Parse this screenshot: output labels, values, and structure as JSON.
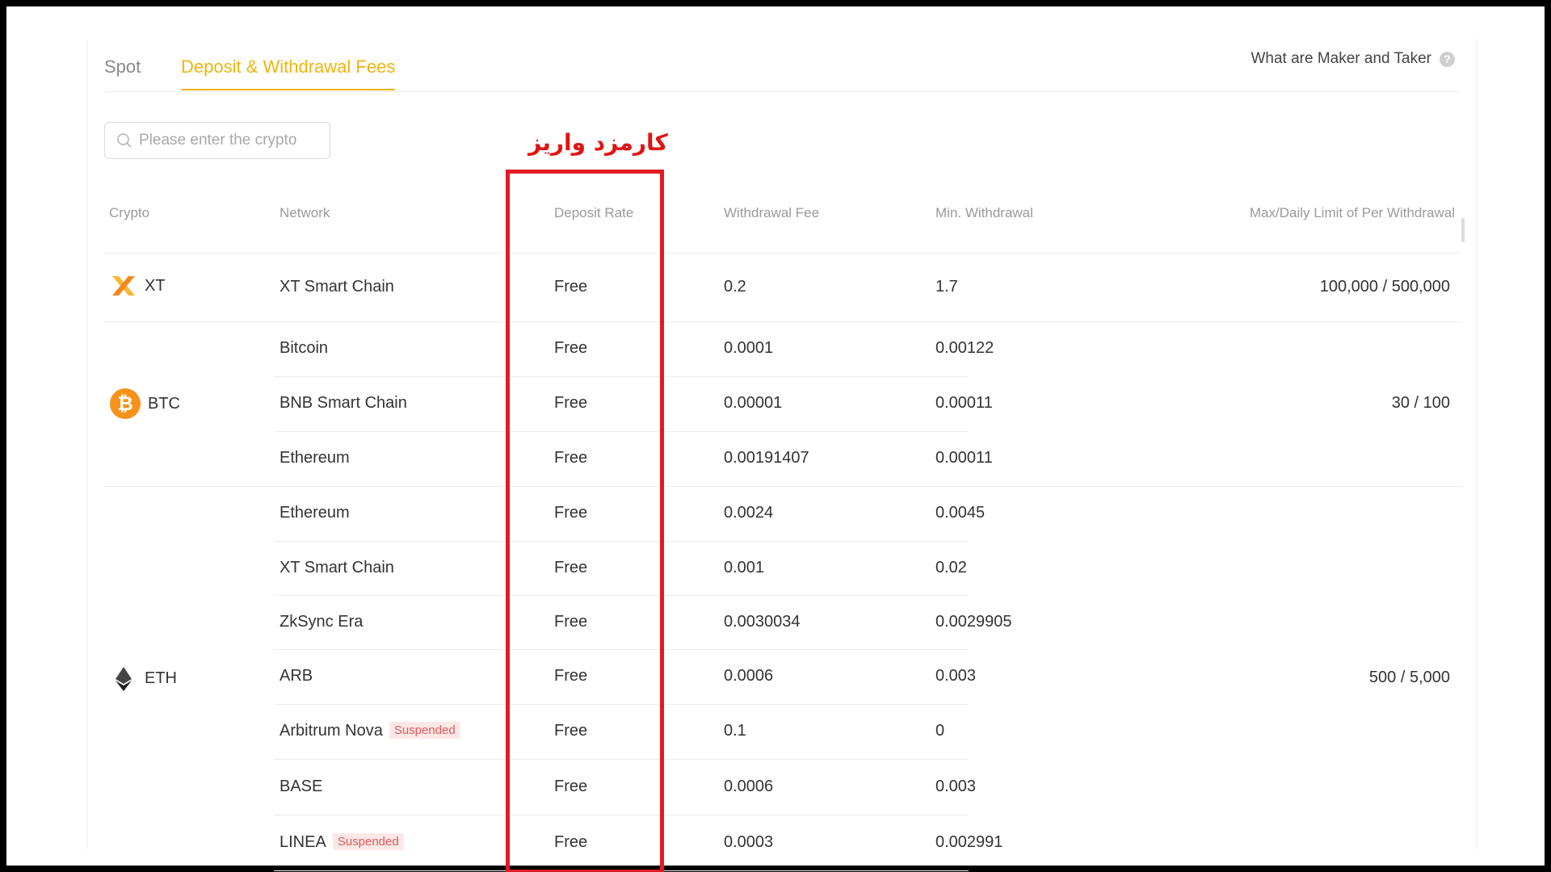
{
  "tabs": [
    {
      "label": "Spot",
      "active": false
    },
    {
      "label": "Deposit & Withdrawal Fees",
      "active": true
    }
  ],
  "help_link": {
    "label": "What are Maker and Taker",
    "icon": "question-icon"
  },
  "search": {
    "placeholder": "Please enter the crypto",
    "value": ""
  },
  "annotation": {
    "label": "کارمزد واریز",
    "color": "#e21b23"
  },
  "colors": {
    "accent": "#f0b40e",
    "annotation": "#e21b23",
    "suspended_bg": "#fde8e8",
    "suspended_text": "#e05a5a"
  },
  "table": {
    "headers": [
      "Crypto",
      "Network",
      "Deposit Rate",
      "Withdrawal Fee",
      "Min. Withdrawal",
      "Max/Daily Limit of Per Withdrawal"
    ],
    "groups": [
      {
        "crypto": "XT",
        "icon": "xt-logo-icon",
        "limit": "100,000 / 500,000",
        "rows": [
          {
            "network": "XT Smart Chain",
            "suspended": "",
            "deposit": "Free",
            "fee": "0.2",
            "min": "1.7"
          }
        ]
      },
      {
        "crypto": "BTC",
        "icon": "bitcoin-logo-icon",
        "limit": "30 / 100",
        "rows": [
          {
            "network": "Bitcoin",
            "suspended": "",
            "deposit": "Free",
            "fee": "0.0001",
            "min": "0.00122"
          },
          {
            "network": "BNB Smart Chain",
            "suspended": "",
            "deposit": "Free",
            "fee": "0.00001",
            "min": "0.00011"
          },
          {
            "network": "Ethereum",
            "suspended": "",
            "deposit": "Free",
            "fee": "0.00191407",
            "min": "0.00011"
          }
        ]
      },
      {
        "crypto": "ETH",
        "icon": "ethereum-logo-icon",
        "limit": "500 / 5,000",
        "rows": [
          {
            "network": "Ethereum",
            "suspended": "",
            "deposit": "Free",
            "fee": "0.0024",
            "min": "0.0045"
          },
          {
            "network": "XT Smart Chain",
            "suspended": "",
            "deposit": "Free",
            "fee": "0.001",
            "min": "0.02"
          },
          {
            "network": "ZkSync Era",
            "suspended": "",
            "deposit": "Free",
            "fee": "0.0030034",
            "min": "0.0029905"
          },
          {
            "network": "ARB",
            "suspended": "",
            "deposit": "Free",
            "fee": "0.0006",
            "min": "0.003"
          },
          {
            "network": "Arbitrum Nova",
            "suspended": "Suspended",
            "deposit": "Free",
            "fee": "0.1",
            "min": "0"
          },
          {
            "network": "BASE",
            "suspended": "",
            "deposit": "Free",
            "fee": "0.0006",
            "min": "0.003"
          },
          {
            "network": "LINEA",
            "suspended": "Suspended",
            "deposit": "Free",
            "fee": "0.0003",
            "min": "0.002991"
          }
        ]
      }
    ]
  }
}
